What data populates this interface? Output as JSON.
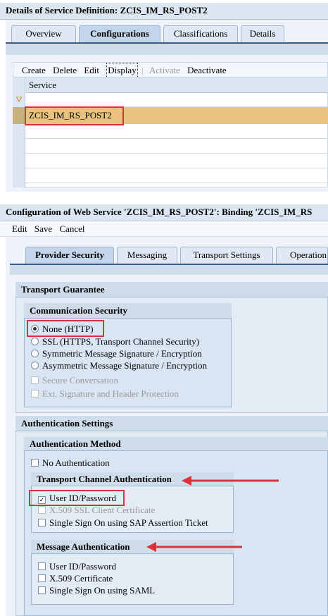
{
  "top": {
    "title": "Details of Service Definition: ZCIS_IM_RS_POST2",
    "tabs": [
      "Overview",
      "Configurations",
      "Classifications",
      "Details"
    ],
    "toolbar": {
      "create": "Create",
      "delete": "Delete",
      "edit": "Edit",
      "display": "Display",
      "activate": "Activate",
      "deactivate": "Deactivate"
    },
    "table": {
      "column": "Service",
      "rows": [
        "ZCIS_IM_RS_POST2",
        "",
        "",
        "",
        ""
      ]
    }
  },
  "bottom": {
    "title": "Configuration of Web Service 'ZCIS_IM_RS_POST2': Binding 'ZCIS_IM_RS",
    "toolbar": {
      "edit": "Edit",
      "save": "Save",
      "cancel": "Cancel"
    },
    "tabs": [
      "Provider Security",
      "Messaging",
      "Transport Settings",
      "Operation"
    ],
    "transport_guarantee": {
      "title": "Transport Guarantee",
      "communication_security": {
        "title": "Communication Security",
        "options": [
          "None (HTTP)",
          "SSL (HTTPS, Transport Channel Security)",
          "Symmetric Message Signature / Encryption",
          "Asymmetric Message Signature / Encryption"
        ],
        "selected": "None (HTTP)",
        "checks": [
          "Secure Conversation",
          "Ext. Signature and Header Protection"
        ]
      }
    },
    "authentication": {
      "title": "Authentication Settings",
      "method_title": "Authentication Method",
      "no_auth": "No Authentication",
      "transport_channel": {
        "title": "Transport Channel Authentication",
        "items": [
          "User ID/Password",
          "X.509 SSL Client Certificate",
          "Single Sign On using SAP Assertion Ticket"
        ]
      },
      "message": {
        "title": "Message Authentication",
        "items": [
          "User ID/Password",
          "X.509 Certificate",
          "Single Sign On using SAML"
        ]
      }
    }
  },
  "colors": {
    "highlight_row": "#e8c27e",
    "annotation_red": "#d9333b"
  }
}
